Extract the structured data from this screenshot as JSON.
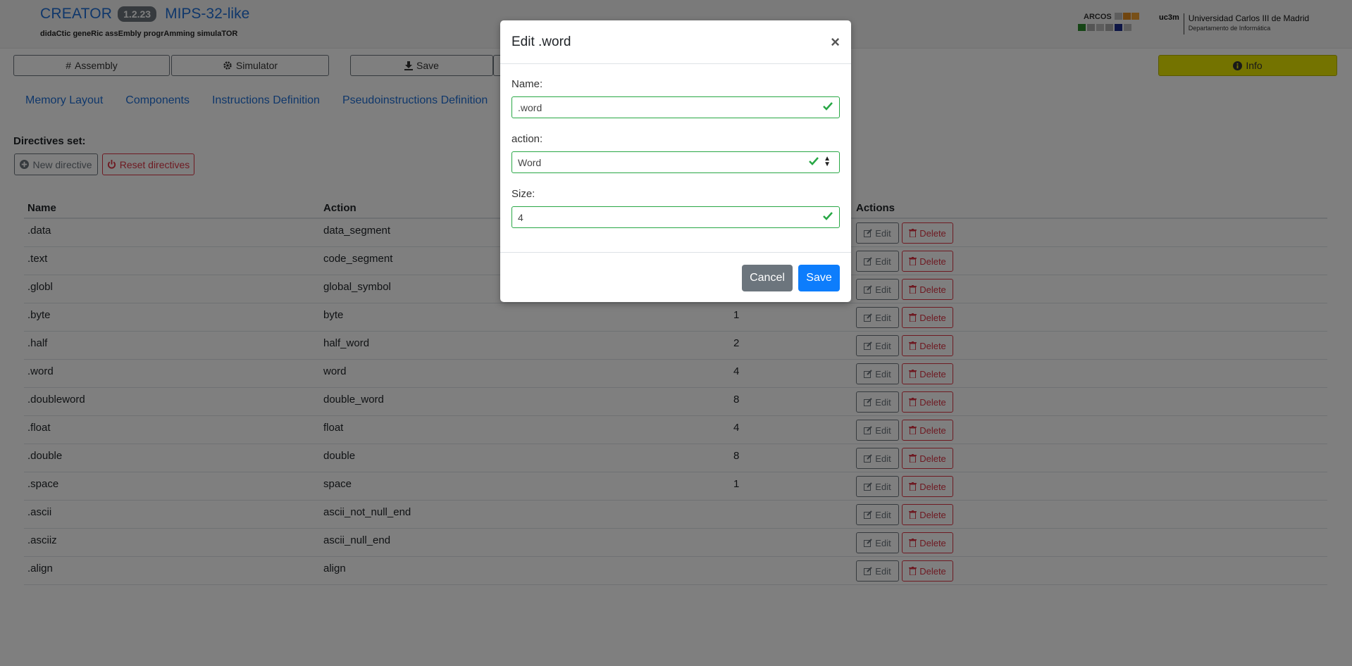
{
  "header": {
    "app_name": "CREATOR",
    "version": "1.2.23",
    "architecture": "MIPS-32-like",
    "subtitle": "didaCtic geneRic assEmbly progrAmming simulaTOR",
    "arcos_label": "ARCOS",
    "uc3m_label": "uc3m",
    "university": "Universidad Carlos III de Madrid",
    "department": "Departamento de Informática"
  },
  "toolbar": {
    "assembly": "Assembly",
    "simulator": "Simulator",
    "save": "Save",
    "info": "Info"
  },
  "tabs": [
    "Memory Layout",
    "Components",
    "Instructions Definition",
    "Pseudoinstructions Definition"
  ],
  "directives": {
    "title": "Directives set:",
    "new_label": "New directive",
    "reset_label": "Reset directives",
    "columns": {
      "name": "Name",
      "action": "Action",
      "actions": "Actions"
    },
    "edit_label": "Edit",
    "delete_label": "Delete",
    "rows": [
      {
        "name": ".data",
        "action": "data_segment",
        "size": ""
      },
      {
        "name": ".text",
        "action": "code_segment",
        "size": ""
      },
      {
        "name": ".globl",
        "action": "global_symbol",
        "size": ""
      },
      {
        "name": ".byte",
        "action": "byte",
        "size": "1"
      },
      {
        "name": ".half",
        "action": "half_word",
        "size": "2"
      },
      {
        "name": ".word",
        "action": "word",
        "size": "4"
      },
      {
        "name": ".doubleword",
        "action": "double_word",
        "size": "8"
      },
      {
        "name": ".float",
        "action": "float",
        "size": "4"
      },
      {
        "name": ".double",
        "action": "double",
        "size": "8"
      },
      {
        "name": ".space",
        "action": "space",
        "size": "1"
      },
      {
        "name": ".ascii",
        "action": "ascii_not_null_end",
        "size": ""
      },
      {
        "name": ".asciiz",
        "action": "ascii_null_end",
        "size": ""
      },
      {
        "name": ".align",
        "action": "align",
        "size": ""
      }
    ]
  },
  "modal": {
    "title": "Edit .word",
    "name_label": "Name:",
    "name_value": ".word",
    "action_label": "action:",
    "action_value": "Word",
    "size_label": "Size:",
    "size_value": "4",
    "cancel": "Cancel",
    "save": "Save"
  },
  "colors": {
    "link": "#1f6fd6",
    "success": "#28a745",
    "danger": "#dc3545",
    "primary": "#0d7dfc",
    "secondary": "#6c757d",
    "info_button": "#e8e600"
  }
}
